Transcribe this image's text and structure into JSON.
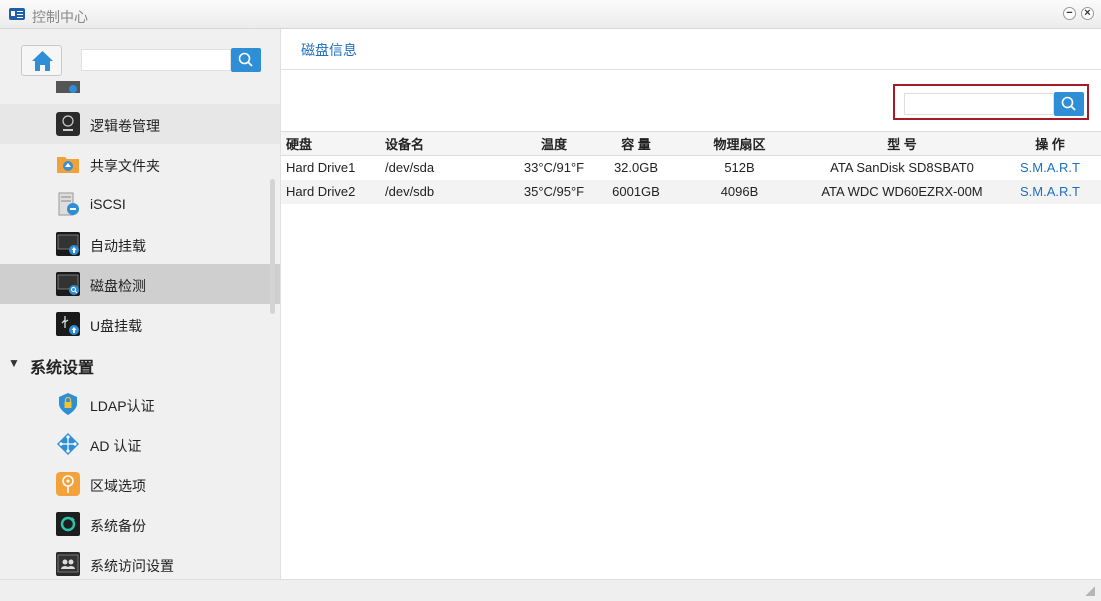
{
  "window": {
    "title": "控制中心",
    "minimize_glyph": "−",
    "close_glyph": "×"
  },
  "sidebar": {
    "items": [
      {
        "label": "逻辑卷管理",
        "icon": "lvm-disk-icon"
      },
      {
        "label": "共享文件夹",
        "icon": "shared-folder-icon"
      },
      {
        "label": "iSCSI",
        "icon": "iscsi-icon"
      },
      {
        "label": "自动挂载",
        "icon": "auto-mount-icon"
      },
      {
        "label": "磁盘检测",
        "icon": "disk-check-icon",
        "selected": true
      },
      {
        "label": "U盘挂载",
        "icon": "usb-mount-icon"
      }
    ],
    "group": {
      "label": "系统设置",
      "arrow": "▼"
    },
    "group_items": [
      {
        "label": "LDAP认证",
        "icon": "ldap-shield-icon"
      },
      {
        "label": "AD 认证",
        "icon": "ad-network-icon"
      },
      {
        "label": "区域选项",
        "icon": "region-location-icon"
      },
      {
        "label": "系统备份",
        "icon": "system-backup-icon"
      },
      {
        "label": "系统访问设置",
        "icon": "access-users-icon"
      }
    ]
  },
  "main": {
    "title": "磁盘信息",
    "table": {
      "headers": [
        "硬盘",
        "设备名",
        "温度",
        "容 量",
        "物理扇区",
        "型 号",
        "操 作"
      ],
      "rows": [
        [
          "Hard Drive1",
          "/dev/sda",
          "33°C/91°F",
          "32.0GB",
          "512B",
          "ATA SanDisk SD8SBAT0",
          "S.M.A.R.T"
        ],
        [
          "Hard Drive2",
          "/dev/sdb",
          "35°C/95°F",
          "6001GB",
          "4096B",
          "ATA WDC WD60EZRX-00M",
          "S.M.A.R.T"
        ]
      ]
    }
  },
  "colors": {
    "accent": "#1e6fbf",
    "search_button": "#2e8fd6",
    "highlight_frame": "#a41c25"
  }
}
